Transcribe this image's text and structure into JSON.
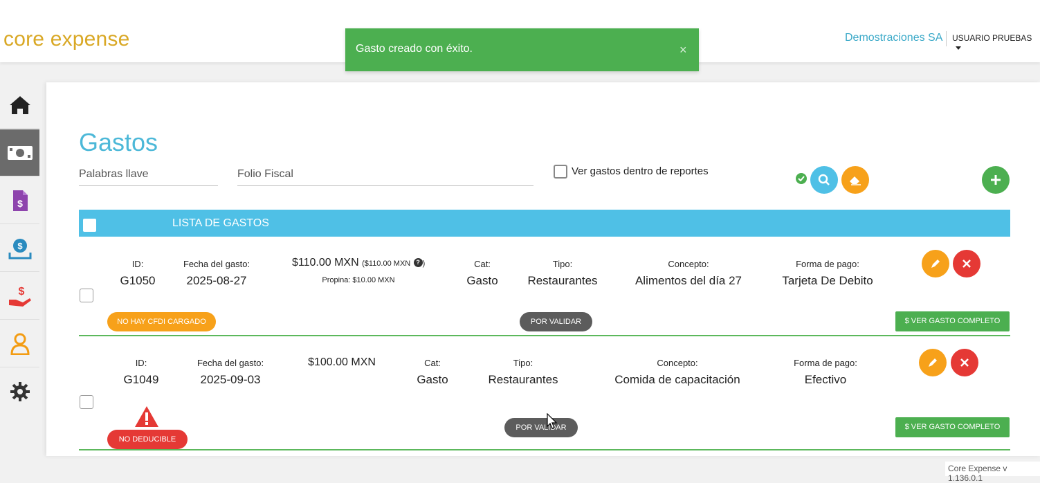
{
  "app": {
    "logo": "core expense",
    "company": "Demostraciones SA",
    "user": "USUARIO PRUEBAS",
    "version": "Core Expense v 1.136.0.1"
  },
  "toast": {
    "message": "Gasto creado con éxito.",
    "close": "×"
  },
  "sidebar": {
    "items": [
      {
        "icon": "home-icon"
      },
      {
        "icon": "money-icon",
        "active": true
      },
      {
        "icon": "invoice-icon"
      },
      {
        "icon": "coin-tray-icon"
      },
      {
        "icon": "hand-money-icon"
      },
      {
        "icon": "user-icon"
      },
      {
        "icon": "gear-icon"
      }
    ]
  },
  "filters": {
    "title": "Gastos",
    "keywords_placeholder": "Palabras llave",
    "folio_placeholder": "Folio Fiscal",
    "within_reports_label": "Ver gastos dentro de reportes"
  },
  "list": {
    "header": "LISTA DE GASTOS"
  },
  "expenses": [
    {
      "id_label": "ID:",
      "id": "G1050",
      "date_label": "Fecha del gasto:",
      "date": "2025-08-27",
      "amount": "$110.00 MXN",
      "amount_note": "($110.00 MXN",
      "tip": "Propina: $10.00 MXN",
      "cat_label": "Cat:",
      "cat": "Gasto",
      "type_label": "Tipo:",
      "type": "Restaurantes",
      "concept_label": "Concepto:",
      "concept": "Alimentos del día 27",
      "payment_label": "Forma de pago:",
      "payment": "Tarjeta De Debito",
      "badge": "NO HAY CFDI CARGADO",
      "status": "POR VALIDAR",
      "view_button": "$ VER GASTO COMPLETO"
    },
    {
      "id_label": "ID:",
      "id": "G1049",
      "date_label": "Fecha del gasto:",
      "date": "2025-09-03",
      "amount": "$100.00 MXN",
      "cat_label": "Cat:",
      "cat": "Gasto",
      "type_label": "Tipo:",
      "type": "Restaurantes",
      "concept_label": "Concepto:",
      "concept": "Comida de capacitación",
      "payment_label": "Forma de pago:",
      "payment": "Efectivo",
      "badge": "NO DEDUCIBLE",
      "status": "POR VALIDAR",
      "view_button": "$ VER GASTO COMPLETO"
    }
  ],
  "colors": {
    "accent": "#4cb8d8",
    "brand": "#d9a825",
    "success": "#4caf50",
    "warning": "#f7a11a",
    "danger": "#e53935"
  }
}
